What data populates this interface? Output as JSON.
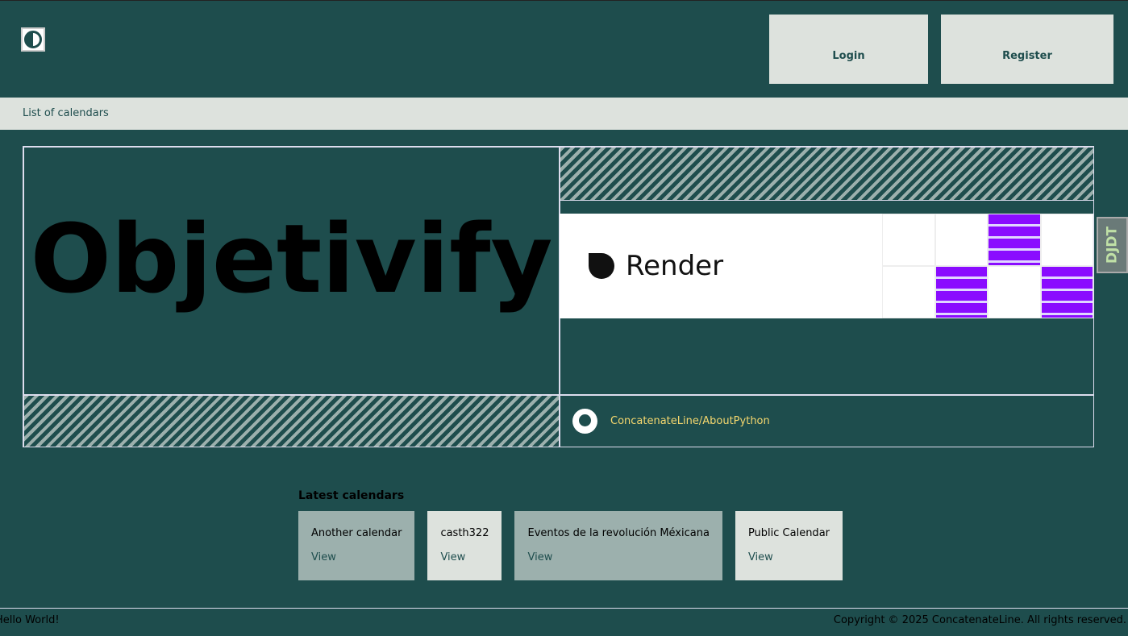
{
  "header": {
    "login": "Login",
    "register": "Register"
  },
  "nav": {
    "list_of_calendars": "List of calendars"
  },
  "hero": {
    "title": "Objetivify",
    "sponsor": "Render",
    "repo_link": "ConcatenateLine/AboutPython"
  },
  "debug_toolbar": "DJDT",
  "latest": {
    "heading": "Latest calendars",
    "cards": [
      {
        "name": "Another calendar",
        "link": "View"
      },
      {
        "name": "casth322",
        "link": "View"
      },
      {
        "name": "Eventos de la revolución Méxicana",
        "link": "View"
      },
      {
        "name": "Public Calendar",
        "link": "View"
      }
    ]
  },
  "footer": {
    "left": "Hello World!",
    "right": "Copyright © 2025 ConcatenateLine. All rights reserved."
  }
}
